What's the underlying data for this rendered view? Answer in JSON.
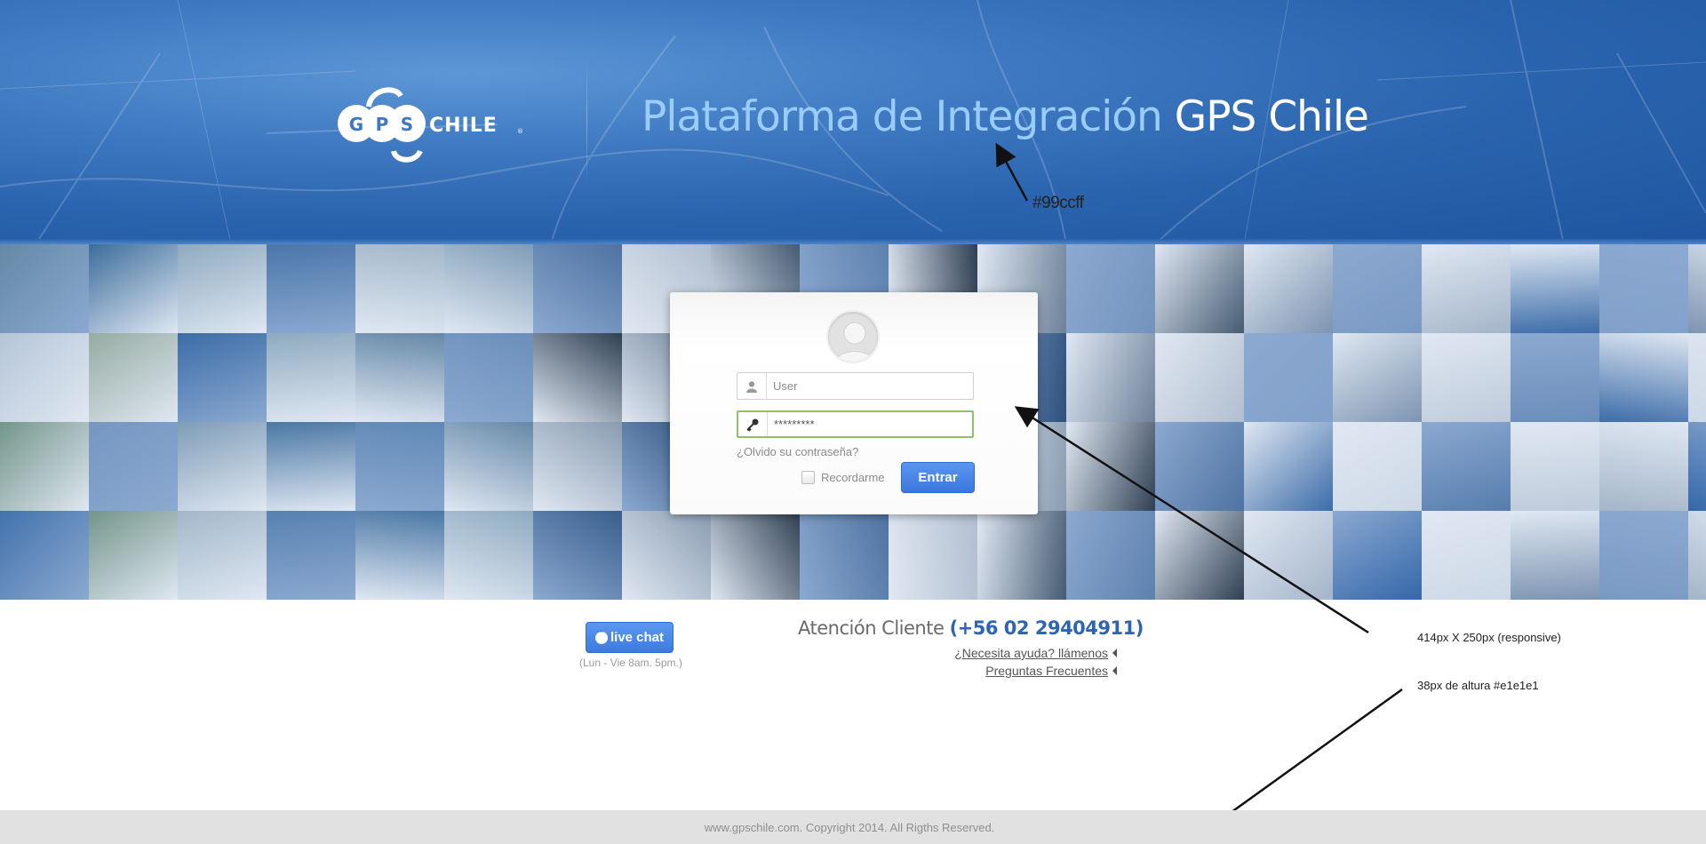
{
  "header": {
    "title_light": "Plataforma de Integración",
    "title_strong": "GPS Chile",
    "logo_text": "GPS CHILE",
    "colors": {
      "band": "#2a63ad",
      "title_light": "#99ccff"
    }
  },
  "login": {
    "user_placeholder": "User",
    "password_value": "*********",
    "forgot_label": "¿Olvido su contraseña?",
    "remember_label": "Recordarme",
    "submit_label": "Entrar",
    "remember_checked": false
  },
  "contact": {
    "livechat_label": "live chat",
    "hours": "(Lun - Vie 8am. 5pm.)",
    "atencion_label": "Atención Cliente",
    "phone": "(+56 02 29404911)",
    "help_link": "¿Necesita ayuda? llámenos",
    "faq_link": "Preguntas Frecuentes"
  },
  "annotations": {
    "title_color": "#99ccff",
    "login_size": "414px X 250px (responsive)",
    "footer_spec": "38px de altura #e1e1e1"
  },
  "footer": {
    "copyright": "www.gpschile.com. Copyright 2014. All Rigths Reserved.",
    "color": "#e1e1e1"
  }
}
